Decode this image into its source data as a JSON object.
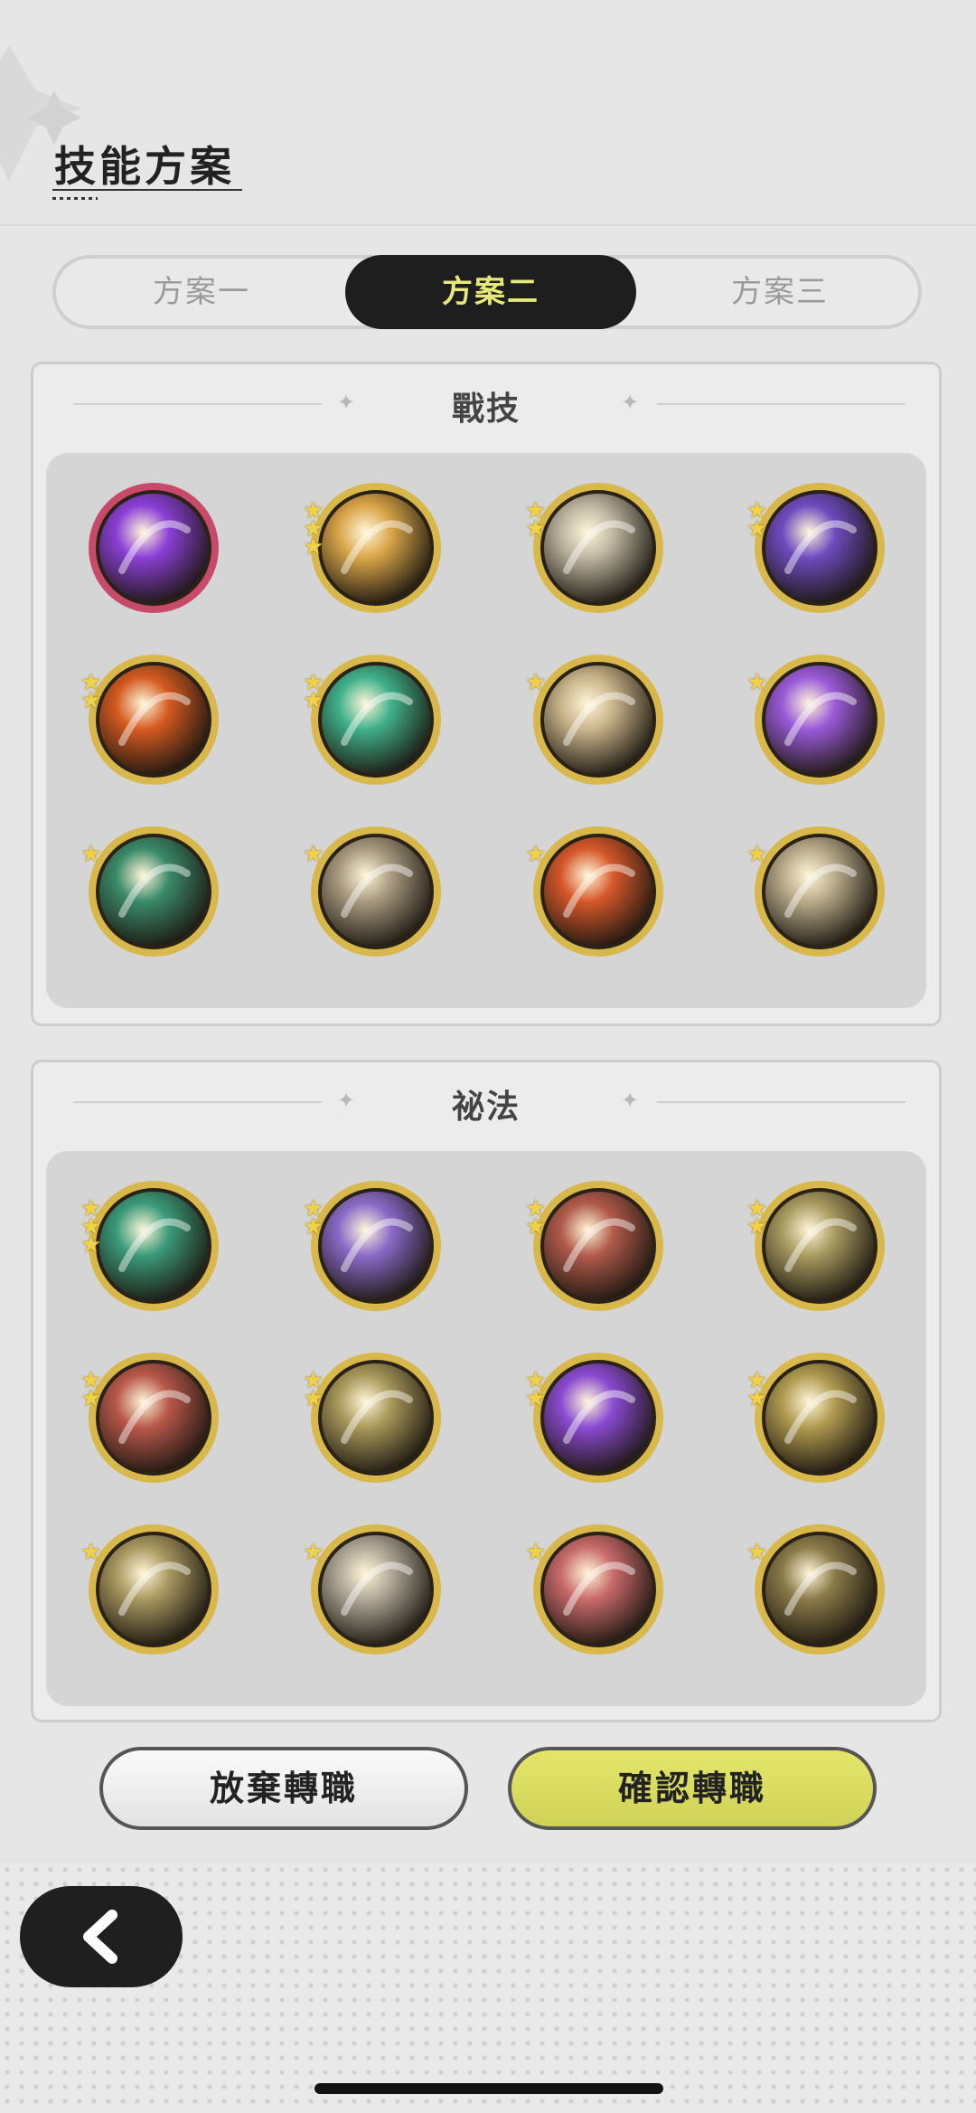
{
  "header": {
    "title": "技能方案"
  },
  "tabs": [
    {
      "label": "方案一",
      "active": false
    },
    {
      "label": "方案二",
      "active": true
    },
    {
      "label": "方案三",
      "active": false
    }
  ],
  "sections": {
    "combat": {
      "title": "戰技",
      "skills": [
        {
          "icon": "purple-heart-skill-icon",
          "stars": 0,
          "ring": "#c84a6a",
          "color": "#8b3fd6"
        },
        {
          "icon": "golden-swirl-skill-icon",
          "stars": 3,
          "ring": "#d8b84a",
          "color": "#d9a548"
        },
        {
          "icon": "slash-strike-skill-icon",
          "stars": 2,
          "ring": "#d8b84a",
          "color": "#bdb5a0"
        },
        {
          "icon": "purple-claw-skill-icon",
          "stars": 2,
          "ring": "#d8b84a",
          "color": "#6e4bbf"
        },
        {
          "icon": "fire-slash-skill-icon",
          "stars": 2,
          "ring": "#d8b84a",
          "color": "#d45a20"
        },
        {
          "icon": "green-arrows-skill-icon",
          "stars": 2,
          "ring": "#d8b84a",
          "color": "#3fb08a"
        },
        {
          "icon": "burst-explosion-skill-icon",
          "stars": 1,
          "ring": "#d8b84a",
          "color": "#c9b48a"
        },
        {
          "icon": "purple-orb-skill-icon",
          "stars": 1,
          "ring": "#d8b84a",
          "color": "#9a5ad8"
        },
        {
          "icon": "green-crescent-skill-icon",
          "stars": 1,
          "ring": "#d8b84a",
          "color": "#3a8a6a"
        },
        {
          "icon": "shadow-spikes-skill-icon",
          "stars": 1,
          "ring": "#d8b84a",
          "color": "#a89a80"
        },
        {
          "icon": "flame-seal-skill-icon",
          "stars": 1,
          "ring": "#d8b84a",
          "color": "#d6582a"
        },
        {
          "icon": "grasping-hand-skill-icon",
          "stars": 1,
          "ring": "#d8b84a",
          "color": "#b9ab8a"
        }
      ]
    },
    "arcane": {
      "title": "祕法",
      "skills": [
        {
          "icon": "healing-circle-skill-icon",
          "stars": 3,
          "ring": "#d8b84a",
          "color": "#3a9a7a"
        },
        {
          "icon": "purple-sphere-skill-icon",
          "stars": 2,
          "ring": "#d8b84a",
          "color": "#8a6ac8"
        },
        {
          "icon": "crimson-shield-skill-icon",
          "stars": 2,
          "ring": "#d8b84a",
          "color": "#b05a4a"
        },
        {
          "icon": "golden-guardian-skill-icon",
          "stars": 2,
          "ring": "#d8b84a",
          "color": "#a89a60"
        },
        {
          "icon": "red-armor-skill-icon",
          "stars": 2,
          "ring": "#d8b84a",
          "color": "#b8584a"
        },
        {
          "icon": "radiant-figure-skill-icon",
          "stars": 2,
          "ring": "#d8b84a",
          "color": "#a8985a"
        },
        {
          "icon": "violet-flame-skill-icon",
          "stars": 2,
          "ring": "#d8b84a",
          "color": "#8a4ad0"
        },
        {
          "icon": "holy-cross-skill-icon",
          "stars": 2,
          "ring": "#d8b84a",
          "color": "#b09a50"
        },
        {
          "icon": "all-seeing-eye-skill-icon",
          "stars": 1,
          "ring": "#d8b84a",
          "color": "#a89860"
        },
        {
          "icon": "pale-blade-skill-icon",
          "stars": 1,
          "ring": "#d8b84a",
          "color": "#b0a898"
        },
        {
          "icon": "red-sword-skill-icon",
          "stars": 1,
          "ring": "#d8b84a",
          "color": "#c86a6a"
        },
        {
          "icon": "golden-vortex-skill-icon",
          "stars": 1,
          "ring": "#d8b84a",
          "color": "#8a7a48"
        }
      ]
    }
  },
  "buttons": {
    "cancel": "放棄轉職",
    "confirm": "確認轉職"
  },
  "colors": {
    "accent": "#e6e87a",
    "confirm_bg": "#d6d95e",
    "dark": "#1e1e1e"
  }
}
